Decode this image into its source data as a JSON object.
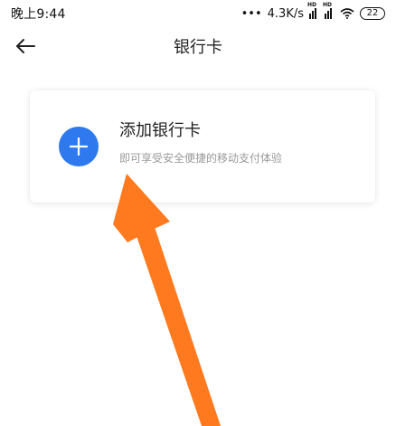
{
  "status_bar": {
    "time": "晚上9:44",
    "network_speed": "4.3K/s",
    "signal1_label": "HD",
    "signal2_label": "HD",
    "battery_level": "22"
  },
  "header": {
    "title": "银行卡"
  },
  "card": {
    "title": "添加银行卡",
    "subtitle": "即可享受安全便捷的移动支付体验"
  },
  "colors": {
    "accent": "#2f79ee",
    "arrow": "#ff7a1e"
  },
  "icons": {
    "back": "back-arrow-icon",
    "add": "plus-icon"
  }
}
